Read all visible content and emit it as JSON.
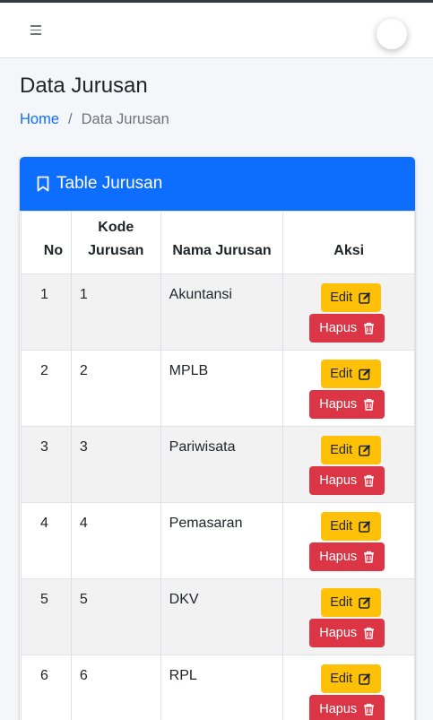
{
  "navbar": {
    "menu_icon": "hamburger-icon"
  },
  "page": {
    "title": "Data Jurusan"
  },
  "breadcrumb": {
    "home": "Home",
    "separator": "/",
    "current": "Data Jurusan"
  },
  "card": {
    "title": "Table Jurusan",
    "icon": "bookmark-icon",
    "header_color": "#0d6efd"
  },
  "table": {
    "headers": {
      "no": "No",
      "kode_line1": "Kode",
      "kode_line2": "Jurusan",
      "nama": "Nama Jurusan",
      "aksi": "Aksi"
    },
    "rows": [
      {
        "no": "1",
        "kode": "1",
        "nama": "Akuntansi",
        "edit": "Edit",
        "hapus": "Hapus"
      },
      {
        "no": "2",
        "kode": "2",
        "nama": "MPLB",
        "edit": "Edit",
        "hapus": "Hapus"
      },
      {
        "no": "3",
        "kode": "3",
        "nama": "Pariwisata",
        "edit": "Edit",
        "hapus": "Hapus"
      },
      {
        "no": "4",
        "kode": "4",
        "nama": "Pemasaran",
        "edit": "Edit",
        "hapus": "Hapus"
      },
      {
        "no": "5",
        "kode": "5",
        "nama": "DKV",
        "edit": "Edit",
        "hapus": "Hapus"
      },
      {
        "no": "6",
        "kode": "6",
        "nama": "RPL",
        "edit": "Edit",
        "hapus": "Hapus"
      }
    ]
  },
  "colors": {
    "edit": "#ffc107",
    "hapus": "#dc3545",
    "link": "#0d6efd"
  }
}
